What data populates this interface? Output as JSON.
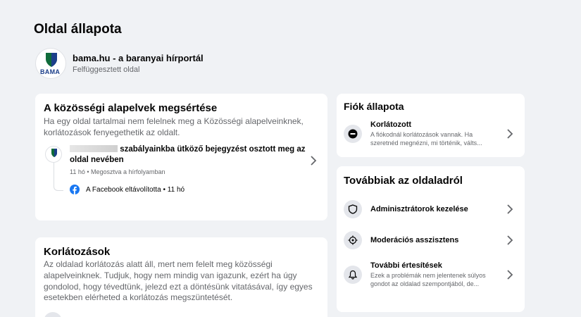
{
  "page": {
    "title": "Oldal állapota",
    "name": "bama.hu - a baranyai hírportál",
    "status": "Felfüggesztett oldal",
    "logo_text": "BAMA"
  },
  "violations_card": {
    "title": "A közösségi alapelvek megsértése",
    "description": "Ha egy oldal tartalmai nem felelnek meg a Közösségi alapelveinknek, korlátozások fenyegethetik az oldalt.",
    "item": {
      "text_line1": "szabályainkba ütköző bejegyzést osztott meg az",
      "text_line2": "oldal nevében",
      "meta": "11 hó • Megosztva a hírfolyamban",
      "removed": "A Facebook eltávolította • 11 hó"
    }
  },
  "restrictions_card": {
    "title": "Korlátozások",
    "description": "Az oldalad korlátozás alatt áll, mert nem felelt meg közösségi alapelveinknek. Tudjuk, hogy nem mindig van igazunk, ezért ha úgy gondolod, hogy tévedtünk, jelezd ezt a döntésünk vitatásával, így egyes esetekben elérheted a korlátozás megszüntetését."
  },
  "account_card": {
    "title": "Fiók állapota",
    "item_label": "Korlátozott",
    "item_sub_line1": "A fiókodnál korlátozások vannak. Ha",
    "item_sub_line2": "szeretnéd megnézni, mi történik, válts..."
  },
  "more_card": {
    "title": "Továbbiak az oldaladról",
    "items": [
      {
        "label": "Adminisztrátorok kezelése",
        "icon": "shield-icon"
      },
      {
        "label": "Moderációs asszisztens",
        "icon": "moderation-icon"
      },
      {
        "label": "További értesítések",
        "icon": "bell-icon",
        "sub_line1": "Ezek a problémák nem jelentenek súlyos",
        "sub_line2": "gondot az oldalad szempontjából, de..."
      }
    ]
  },
  "colors": {
    "facebook_blue": "#1877f2",
    "brand_green": "#0f6b3a",
    "brand_navy": "#1c3f8a"
  }
}
